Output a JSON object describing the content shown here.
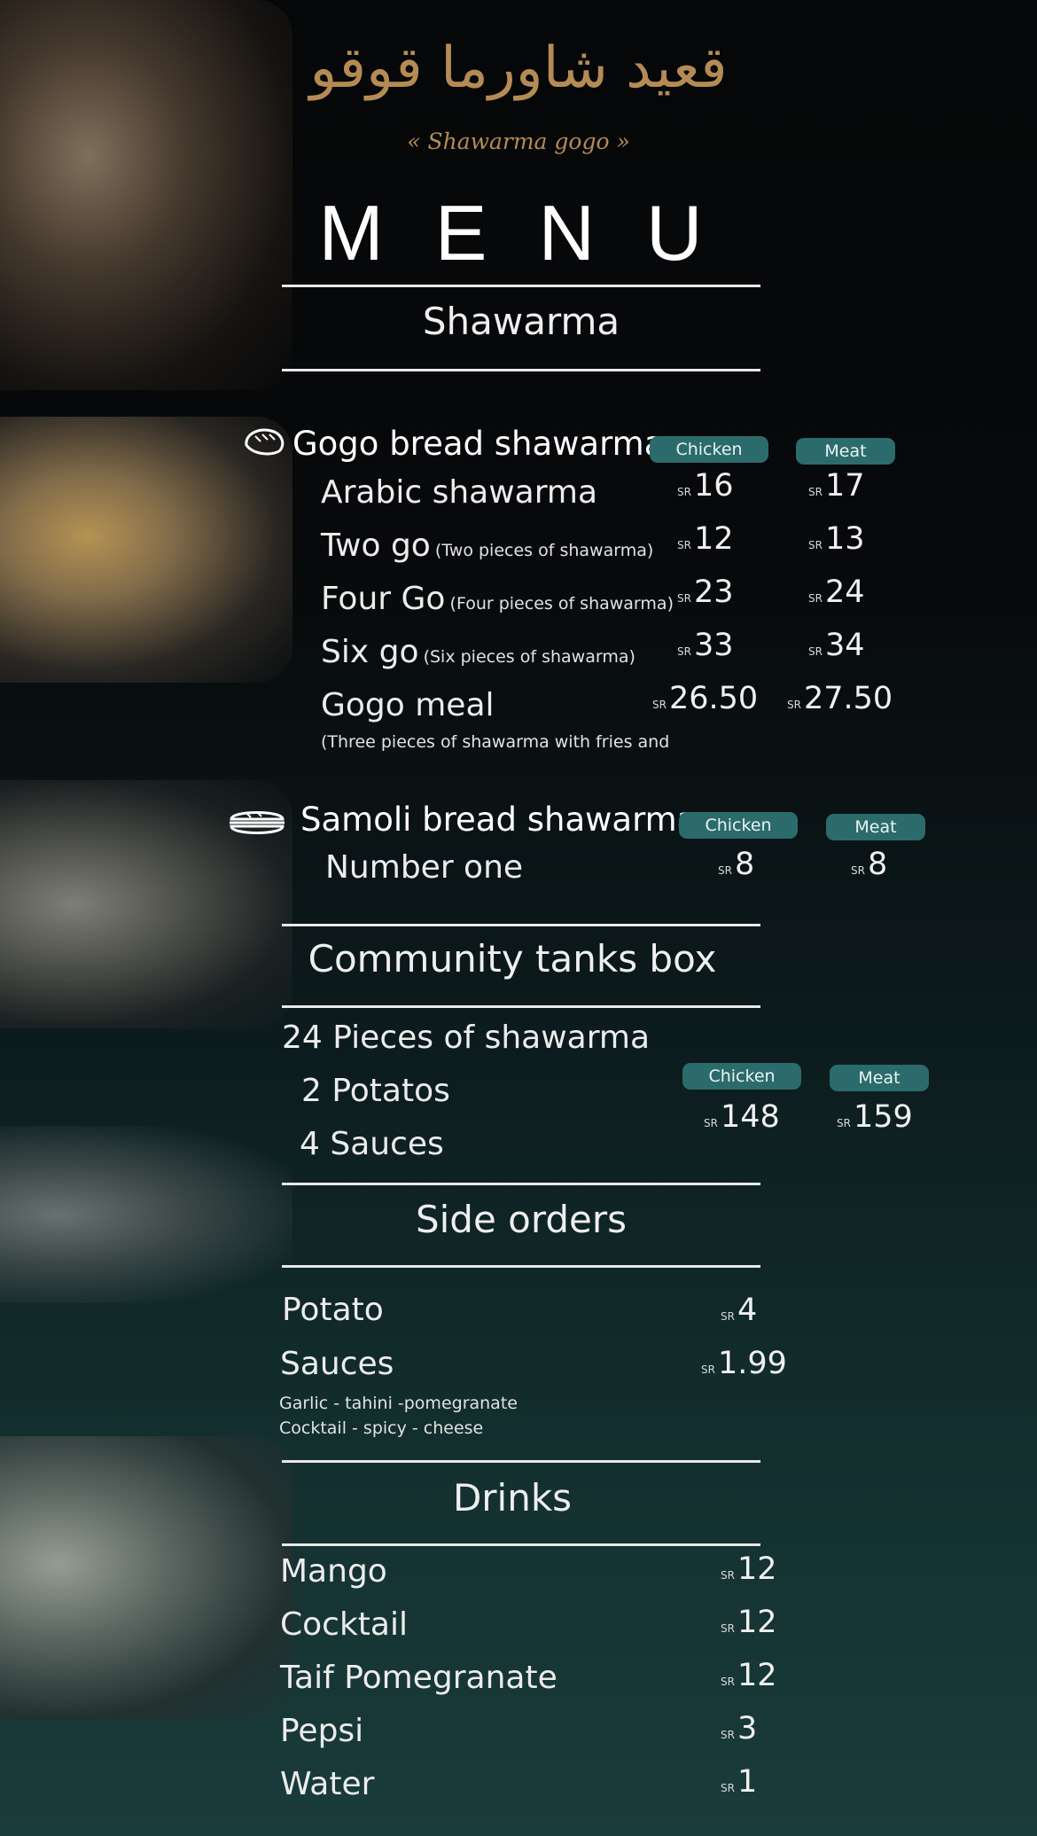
{
  "brand": {
    "logo_arabic": "قعيد شاورما قوقو",
    "logo_latin": "« Shawarma gogo »"
  },
  "menu_title": "MENU",
  "currency": "SR",
  "sections": {
    "shawarma": "Shawarma",
    "community": "Community tanks box",
    "sides": "Side orders",
    "drinks": "Drinks"
  },
  "gogo": {
    "title": "Gogo bread shawarma",
    "icon": "bread-icon",
    "col_chicken": "Chicken",
    "col_meat": "Meat",
    "items": [
      {
        "name": "Arabic shawarma",
        "note": "",
        "chicken": "16",
        "meat": "17"
      },
      {
        "name": "Two go",
        "note": "(Two pieces of shawarma)",
        "chicken": "12",
        "meat": "13"
      },
      {
        "name": "Four Go",
        "note": "(Four pieces of shawarma)",
        "chicken": "23",
        "meat": "24"
      },
      {
        "name": "Six go",
        "note": "(Six pieces of shawarma)",
        "chicken": "33",
        "meat": "34"
      },
      {
        "name": "Gogo meal",
        "note": "(Three pieces of shawarma with fries and",
        "chicken": "26.50",
        "meat": "27.50"
      }
    ]
  },
  "samoli": {
    "title": "Samoli bread shawarma",
    "icon": "sandwich-icon",
    "col_chicken": "Chicken",
    "col_meat": "Meat",
    "items": [
      {
        "name": "Number one",
        "chicken": "8",
        "meat": "8"
      }
    ]
  },
  "community_box": {
    "lines": [
      "24 Pieces of shawarma",
      "2 Potatos",
      "4 Sauces"
    ],
    "col_chicken": "Chicken",
    "col_meat": "Meat",
    "chicken": "148",
    "meat": "159"
  },
  "sides": {
    "items": [
      {
        "name": "Potato",
        "price": "4"
      },
      {
        "name": "Sauces",
        "price": "1.99"
      }
    ],
    "sauce_list_1": "Garlic - tahini -pomegranate",
    "sauce_list_2": "Cocktail - spicy - cheese"
  },
  "drinks": {
    "items": [
      {
        "name": "Mango",
        "price": "12"
      },
      {
        "name": "Cocktail",
        "price": "12"
      },
      {
        "name": "Taif Pomegranate",
        "price": "12"
      },
      {
        "name": "Pepsi",
        "price": "3"
      },
      {
        "name": "Water",
        "price": "1"
      }
    ]
  },
  "colors": {
    "accent_pill": "#2b6b6b",
    "logo_gold": "#b58b55",
    "background_bottom": "#1a3c3b"
  }
}
